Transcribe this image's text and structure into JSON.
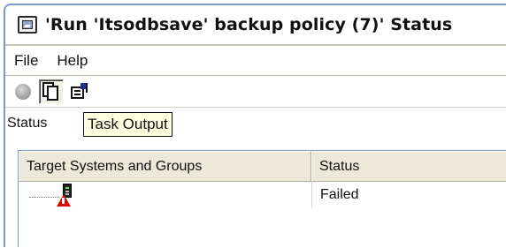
{
  "window": {
    "title": "'Run 'Itsodbsave' backup policy (7)' Status",
    "icon": "status-window-icon"
  },
  "menubar": {
    "items": [
      {
        "label": "File"
      },
      {
        "label": "Help"
      }
    ]
  },
  "toolbar": {
    "buttons": [
      {
        "icon": "stop-icon"
      },
      {
        "icon": "task-output-icon"
      },
      {
        "icon": "properties-icon"
      }
    ]
  },
  "status": {
    "label": "Status",
    "tooltip": "Task Output"
  },
  "table": {
    "columns": [
      "Target Systems and Groups",
      "Status"
    ],
    "rows": [
      {
        "target": "",
        "status": "Failed",
        "icon": "system-warning-icon"
      }
    ]
  },
  "colors": {
    "title_border": "#7a99c9",
    "tooltip_bg": "#ffffe1",
    "header_bg": "#ece9d8",
    "warning": "#e00000"
  }
}
